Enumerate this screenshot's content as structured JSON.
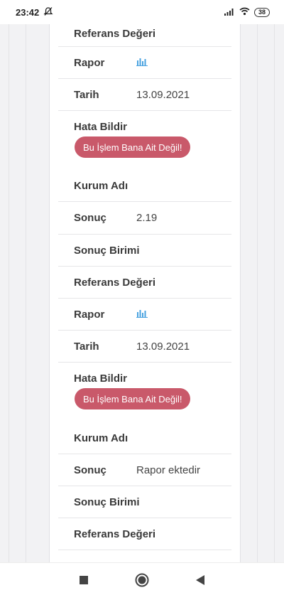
{
  "status": {
    "time": "23:42",
    "battery": "38"
  },
  "labels": {
    "ref": "Referans Değeri",
    "report": "Rapor",
    "date": "Tarih",
    "error": "Hata Bildir",
    "institution": "Kurum Adı",
    "result": "Sonuç",
    "unit": "Sonuç Birimi"
  },
  "records": [
    {
      "date": "13.09.2021",
      "report_button": "Bu İşlem Bana Ait Değil!"
    },
    {
      "result": "2.19",
      "date": "13.09.2021",
      "report_button": "Bu İşlem Bana Ait Değil!"
    },
    {
      "result": "Rapor ektedir"
    }
  ],
  "colors": {
    "accent_button": "#c9596a",
    "chart_icon": "#4aa3e0"
  }
}
